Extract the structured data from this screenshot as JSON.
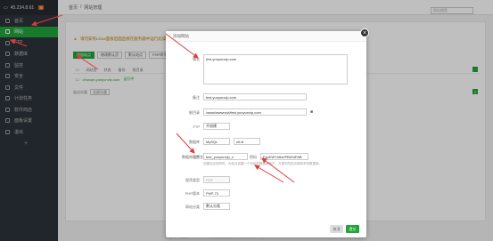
{
  "sidebar": {
    "server_ip": "45.234.8.61",
    "badge": "0",
    "items": [
      {
        "label": "首页",
        "icon": "home-icon"
      },
      {
        "label": "网站",
        "icon": "globe-icon",
        "active": true
      },
      {
        "label": "FTP",
        "icon": "ftp-icon"
      },
      {
        "label": "数据库",
        "icon": "database-icon"
      },
      {
        "label": "监控",
        "icon": "monitor-icon"
      },
      {
        "label": "安全",
        "icon": "shield-icon"
      },
      {
        "label": "文件",
        "icon": "folder-icon"
      },
      {
        "label": "计划任务",
        "icon": "clock-icon"
      },
      {
        "label": "软件商店",
        "icon": "store-icon"
      },
      {
        "label": "面板设置",
        "icon": "gear-icon"
      },
      {
        "label": "退出",
        "icon": "logout-icon"
      }
    ],
    "add_symbol": "+"
  },
  "topbar": {
    "home": "首页",
    "separator": "/",
    "current": "网站管理",
    "search_placeholder": "网站搜索"
  },
  "content": {
    "warning": "请勿安装Linux面板后面直接在服务器中运行此操作，可能会导致面板故障",
    "buttons": [
      "添加站点",
      "修改默认页",
      "默认站点",
      "PHP命令行版本"
    ],
    "table_headers": [
      "网站名",
      "状态",
      "备份",
      "根目录"
    ],
    "row_site": "zhunqin.yunyunvip.com",
    "row_status": "运行中",
    "sort_label": "站点分类",
    "sort_value": "全部分类",
    "page_num": "1",
    "footer": "宝塔Linux面板 ©2014-2020 广东堡塔安全技术有限公司 (bt.cn)"
  },
  "modal": {
    "title": "添加网站",
    "close": "×",
    "labels": {
      "domain": "域名",
      "note": "备注",
      "root": "根目录",
      "ftp": "FTP",
      "database": "数据库",
      "db_account": "数据库设置",
      "program_type": "程序类型",
      "php_version": "PHP版本",
      "category": "网站分类"
    },
    "domain_value": "test.yunyunvip.com",
    "note_value": "test.yunyunvip.com",
    "root_value": "/www/wwwroot/test.yunyunvip.com",
    "ftp_value": "不创建",
    "db_type": "MySQL",
    "db_charset": "utf-8",
    "db_user_label": "用户名",
    "db_user": "test_yunyunvip_c",
    "db_pass_label": "密码",
    "db_pass": "FzpKWYh6znPBiG4FAB",
    "db_hint": "创建站点的同时，为站点创建一个对应的数据库帐户，方便不同站点使用不同数据库。",
    "program_type": "PHP",
    "php_version": "PHP-73",
    "category": "默认分类",
    "cancel": "取消",
    "submit": "提交"
  },
  "accent_green": "#20a53a",
  "arrow_red": "#e03b3b"
}
